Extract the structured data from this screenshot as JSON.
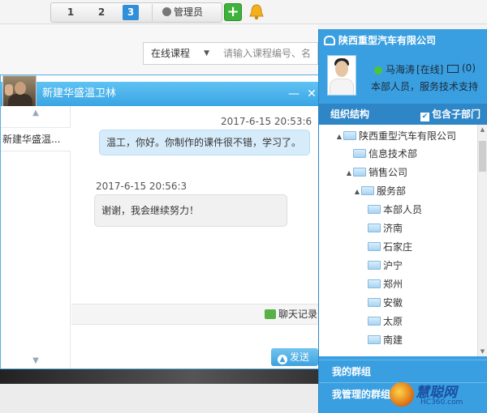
{
  "toolbar": {
    "pages": [
      "1",
      "2",
      "3"
    ],
    "active_page": "3",
    "admin_label": "管理员"
  },
  "search": {
    "course_type": "在线课程",
    "placeholder": "请输入课程编号、名"
  },
  "chat": {
    "title": "新建华盛温卫林",
    "sessions": [
      {
        "label": "新建华盛温..."
      }
    ],
    "messages": [
      {
        "time": "2017-6-15 20:53:6",
        "text": "温工，你好。你制作的课件很不错，学习了。",
        "side": "me"
      },
      {
        "time": "2017-6-15 20:56:3",
        "text": "谢谢，我会继续努力！",
        "side": "other"
      }
    ],
    "history_label": "聊天记录",
    "send_label": "发送"
  },
  "panel": {
    "company": "陕西重型汽车有限公司",
    "user_name": "马海涛",
    "user_status": "[在线]",
    "mail_count": "(0)",
    "user_dept": "本部人员，服务技术支持",
    "org_label": "组织结构",
    "include_sub_label": "包含子部门",
    "tree": [
      {
        "label": "陕西重型汽车有限公司",
        "level": 0,
        "toggle": "▲"
      },
      {
        "label": "信息技术部",
        "level": 1,
        "toggle": ""
      },
      {
        "label": "销售公司",
        "level": 1,
        "toggle": "▲"
      },
      {
        "label": "服务部",
        "level": 2,
        "toggle": "▲"
      },
      {
        "label": "本部人员",
        "level": 3,
        "toggle": ""
      },
      {
        "label": "济南",
        "level": 3,
        "toggle": ""
      },
      {
        "label": "石家庄",
        "level": 3,
        "toggle": ""
      },
      {
        "label": "沪宁",
        "level": 3,
        "toggle": ""
      },
      {
        "label": "郑州",
        "level": 3,
        "toggle": ""
      },
      {
        "label": "安徽",
        "level": 3,
        "toggle": ""
      },
      {
        "label": "太原",
        "level": 3,
        "toggle": ""
      },
      {
        "label": "南建",
        "level": 3,
        "toggle": ""
      }
    ],
    "my_groups": "我的群组",
    "managed_groups": "我管理的群组"
  },
  "watermark": {
    "brand": "慧聪网",
    "site": "HC360.com"
  },
  "colors": {
    "accent": "#3a9fe0",
    "title_bar": "#4fb6ee",
    "online": "#4ac43b",
    "add_button": "#3fb23a"
  }
}
